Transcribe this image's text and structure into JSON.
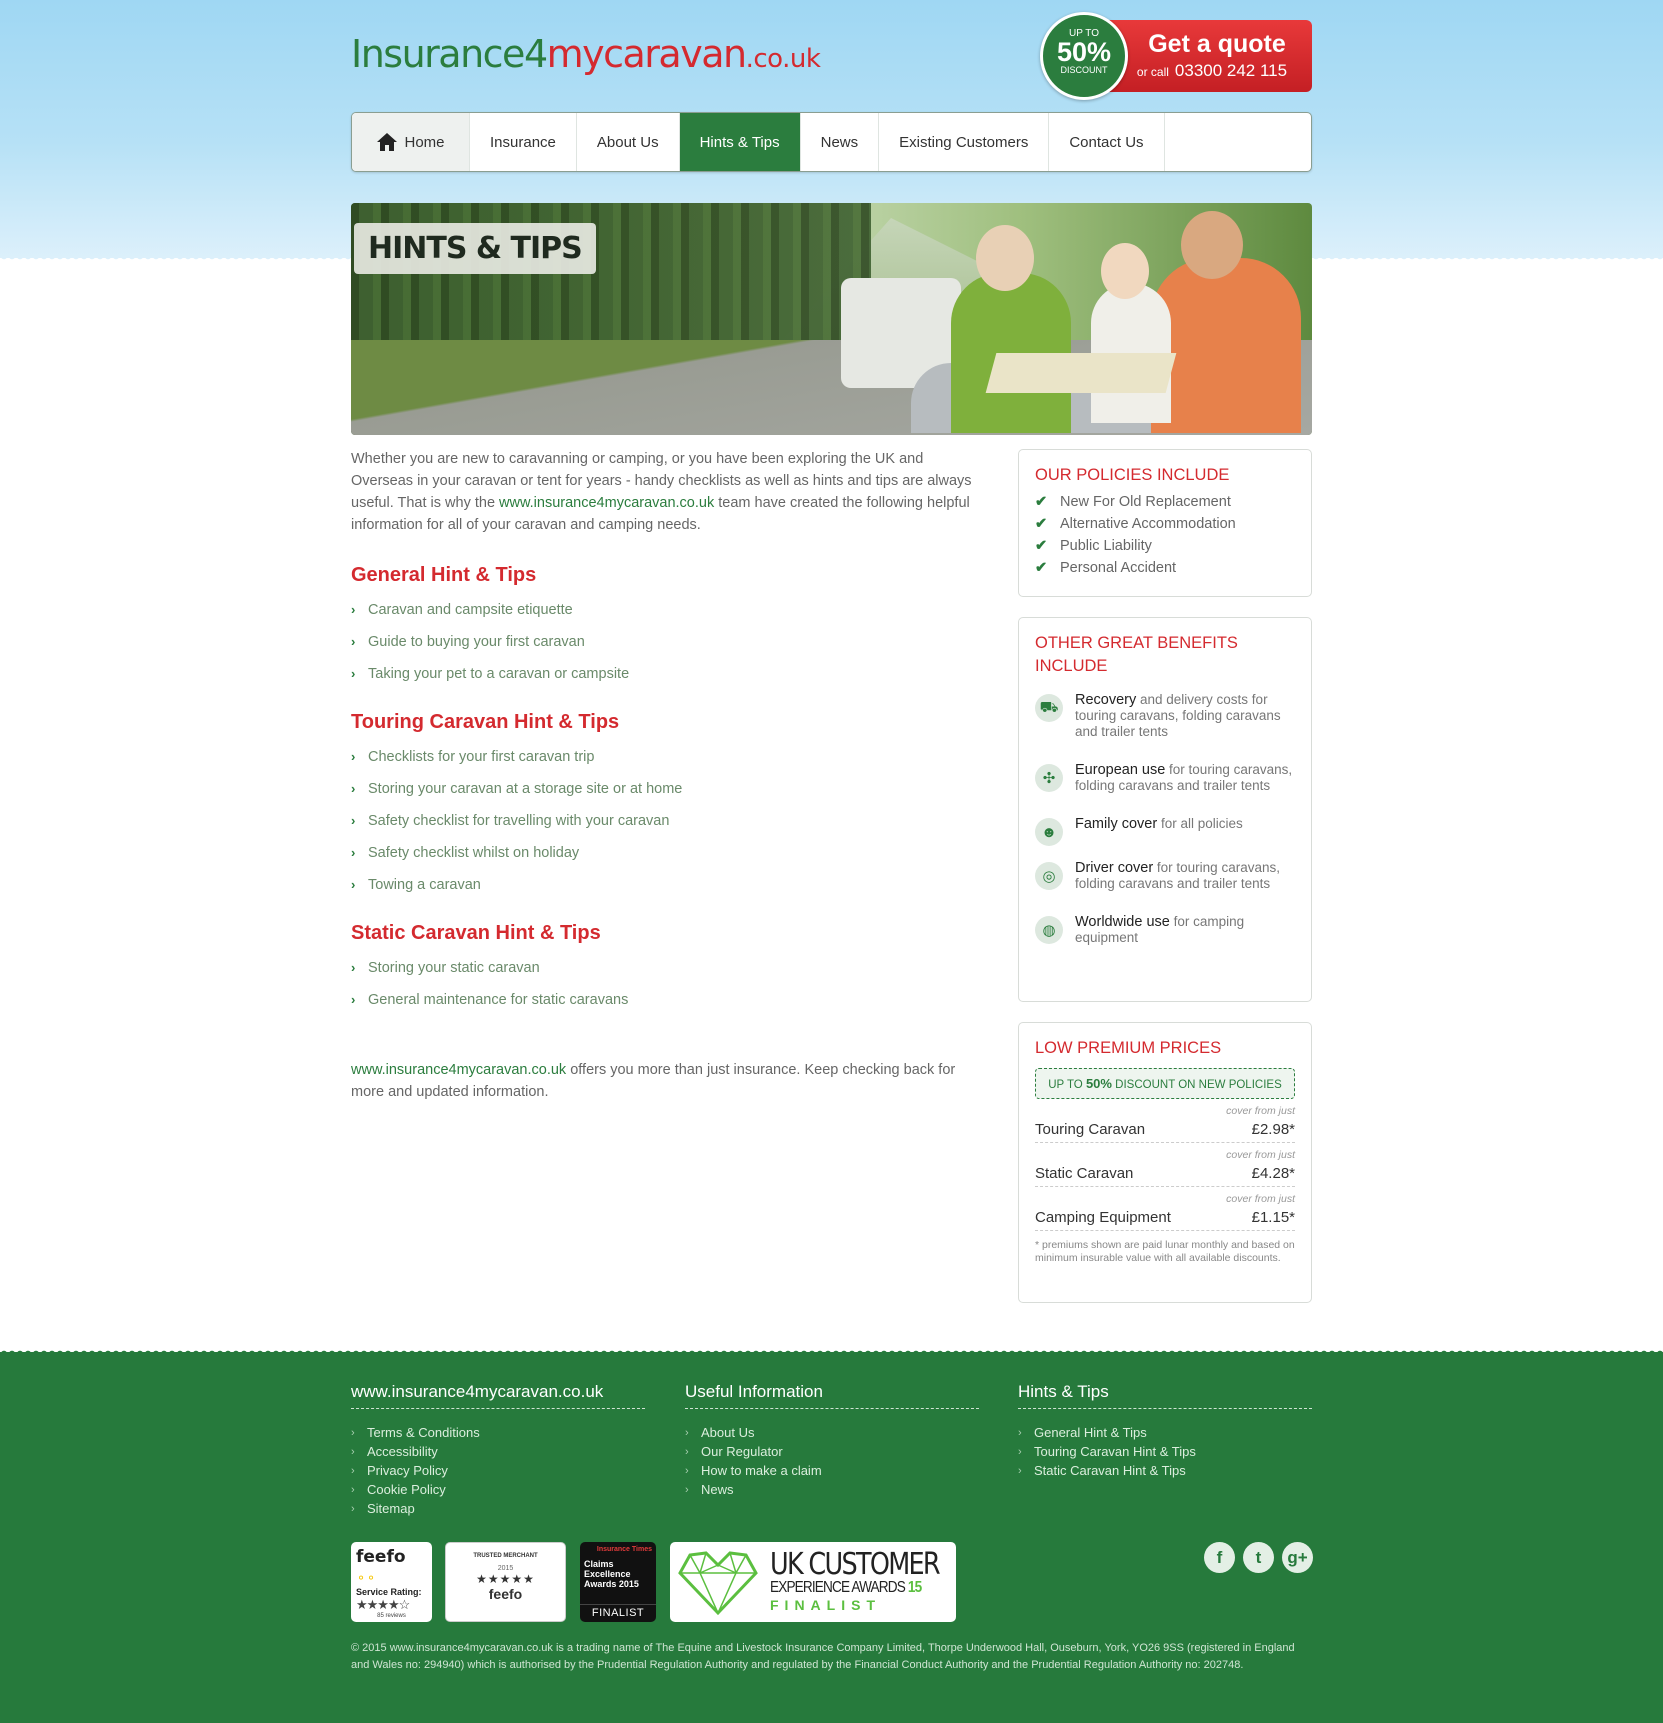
{
  "header": {
    "logo_part1": "Insurance4",
    "logo_part2": "mycaravan",
    "logo_tld": ".co.uk",
    "discount_top": "UP TO",
    "discount_value": "50%",
    "discount_bottom": "DISCOUNT",
    "quote_label": "Get a quote",
    "call_prefix": "or call",
    "phone": "03300 242 115"
  },
  "nav": {
    "items": [
      {
        "label": "Home"
      },
      {
        "label": "Insurance"
      },
      {
        "label": "About Us"
      },
      {
        "label": "Hints & Tips"
      },
      {
        "label": "News"
      },
      {
        "label": "Existing Customers"
      },
      {
        "label": "Contact Us"
      }
    ],
    "active": "Hints & Tips"
  },
  "banner": {
    "title": "HINTS & TIPS"
  },
  "main": {
    "intro_before": "Whether you are new to caravanning or camping, or you have been exploring the UK and Overseas in your caravan or tent for years - handy checklists as well as hints and tips are always useful. That is why the ",
    "intro_link": "www.insurance4mycaravan.co.uk",
    "intro_after": " team have created the following helpful information for all of your caravan and camping needs.",
    "sections": [
      {
        "title": "General Hint & Tips",
        "items": [
          "Caravan and campsite etiquette",
          "Guide to buying your first caravan",
          "Taking your pet to a caravan or campsite"
        ]
      },
      {
        "title": "Touring Caravan Hint & Tips",
        "items": [
          "Checklists for your first caravan trip",
          "Storing your caravan at a storage site or at home",
          "Safety checklist for travelling with your caravan",
          "Safety checklist whilst on holiday",
          "Towing a caravan"
        ]
      },
      {
        "title": "Static Caravan Hint & Tips",
        "items": [
          "Storing your static caravan",
          "General maintenance for static caravans"
        ]
      }
    ],
    "outro_link": "www.insurance4mycaravan.co.uk",
    "outro_text": " offers you more than just insurance. Keep checking back for more and updated information."
  },
  "sidebar": {
    "policies": {
      "title": "OUR POLICIES INCLUDE",
      "items": [
        "New For Old Replacement",
        "Alternative Accommodation",
        "Public Liability",
        "Personal Accident"
      ]
    },
    "benefits": {
      "title": "OTHER GREAT BENEFITS INCLUDE",
      "items": [
        {
          "bold": "Recovery",
          "text": " and delivery costs for touring caravans, folding caravans and trailer tents",
          "icon": "truck-icon"
        },
        {
          "bold": "European use",
          "text": " for touring caravans, folding caravans and trailer tents",
          "icon": "europe-icon"
        },
        {
          "bold": "Family cover",
          "text": " for all policies",
          "icon": "family-icon"
        },
        {
          "bold": "Driver cover",
          "text": " for touring caravans, folding caravans and trailer tents",
          "icon": "steering-wheel-icon"
        },
        {
          "bold": "Worldwide use",
          "text": " for camping equipment",
          "icon": "globe-icon"
        }
      ]
    },
    "prices": {
      "title": "LOW PREMIUM PRICES",
      "promo_prefix": "UP TO ",
      "promo_value": "50%",
      "promo_suffix": " DISCOUNT ON NEW POLICIES",
      "from_label": "cover from just",
      "rows": [
        {
          "name": "Touring Caravan",
          "value": "£2.98*"
        },
        {
          "name": "Static Caravan",
          "value": "£4.28*"
        },
        {
          "name": "Camping Equipment",
          "value": "£1.15*"
        }
      ],
      "note": "* premiums shown are paid lunar monthly and based on minimum insurable value with all available discounts."
    }
  },
  "footer": {
    "col1": {
      "title": "www.insurance4mycaravan.co.uk",
      "items": [
        "Terms & Conditions",
        "Accessibility",
        "Privacy Policy",
        "Cookie Policy",
        "Sitemap"
      ]
    },
    "col2": {
      "title": "Useful Information",
      "items": [
        "About Us",
        "Our Regulator",
        "How to make a claim",
        "News"
      ]
    },
    "col3": {
      "title": "Hints & Tips",
      "items": [
        "General Hint & Tips",
        "Touring Caravan Hint & Tips",
        "Static Caravan Hint & Tips"
      ]
    },
    "badges": {
      "feefo_logo": "feefo",
      "feefo_rating_label": "Service Rating:",
      "feefo_stars": "★★★★☆",
      "feefo_reviews": "85 reviews",
      "trusted_label": "TRUSTED MERCHANT",
      "trusted_year": "2015",
      "trusted_stars": "★★★★★",
      "trusted_logo": "feefo",
      "claims_source": "Insurance Times",
      "claims_title": "Claims Excellence Awards 2015",
      "claims_status": "FINALIST",
      "ukcx_l1": "UK CUSTOMER",
      "ukcx_l2": "EXPERIENCE AWARDS",
      "ukcx_year": "15",
      "ukcx_l3": "FINALIST"
    },
    "social": [
      "f",
      "t",
      "g+"
    ],
    "legal": "© 2015 www.insurance4mycaravan.co.uk is a trading name of The Equine and Livestock Insurance Company Limited, Thorpe Underwood Hall, Ouseburn, York, YO26 9SS (registered in England and Wales no: 294940) which is authorised by the Prudential Regulation Authority and regulated by the Financial Conduct Authority and the Prudential Regulation Authority no: 202748."
  },
  "colors": {
    "brand_green": "#2b7d3e",
    "accent_red": "#d42a2f",
    "sky": "#9fd7f3",
    "footer_green": "#267a3c"
  }
}
